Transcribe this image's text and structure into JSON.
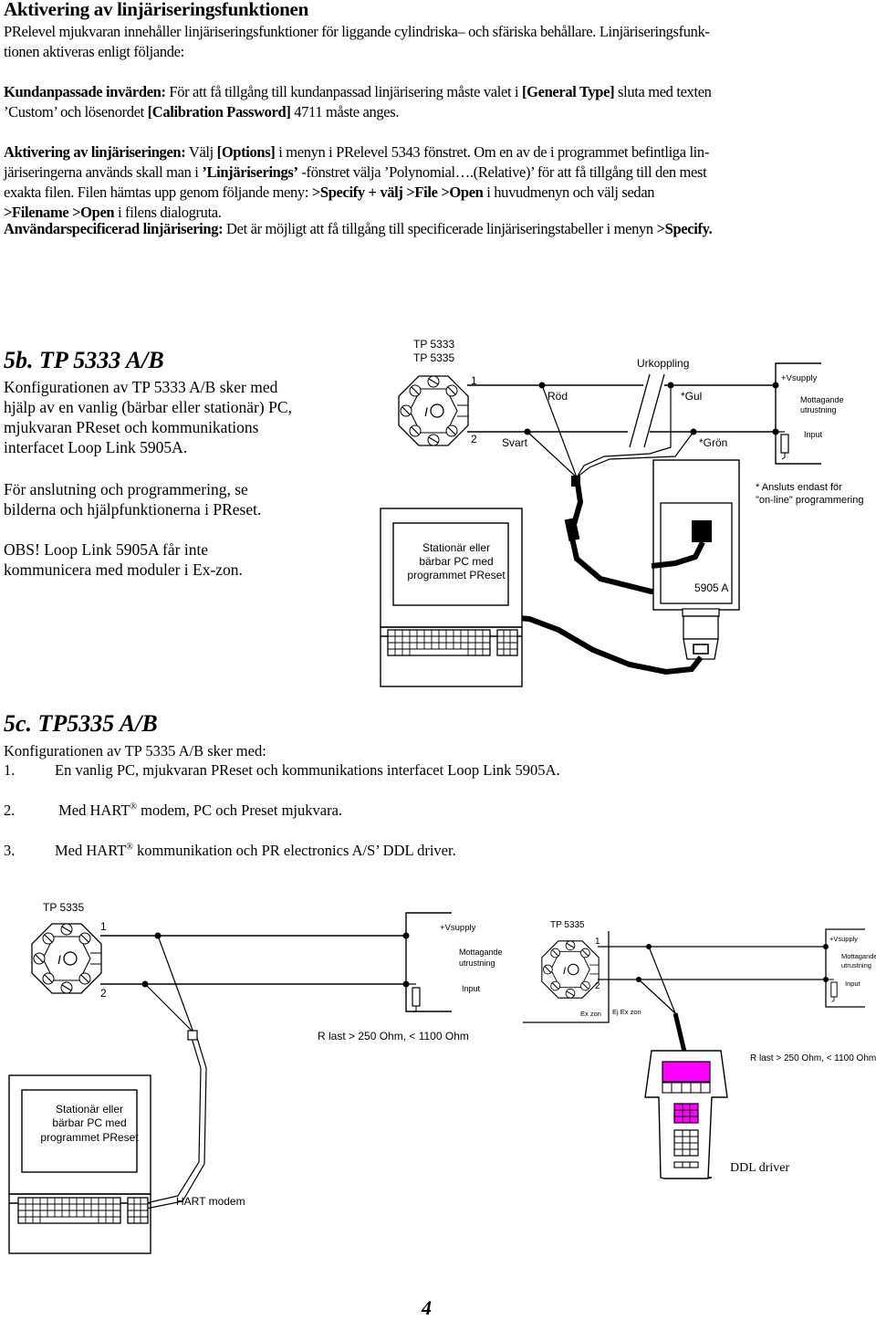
{
  "section_a": {
    "title": "Aktivering av linjäriseringsfunktionen",
    "intro_line1": "PRelevel mjukvaran innehåller linjäriseringsfunktioner för liggande cylindriska– och sfäriska behållare. Linjäriseringsfunk-",
    "intro_line2": "tionen aktiveras enligt följande:",
    "custom": {
      "label": "Kundanpassade invärden:",
      "t1": " För att få tillgång till kundanpassad linjärisering måste valet i ",
      "b1": "[General Type]",
      "t2": " sluta med texten",
      "t3": "’Custom’ och lösenordet ",
      "b2": "[Calibration Password]",
      "t4": " 4711 måste anges."
    },
    "activate": {
      "label": "Aktivering av linjäriseringen:",
      "t1": " Välj ",
      "b1": "[Options]",
      "t2": " i menyn i PRelevel 5343 fönstret. Om en av de i programmet befintliga lin-",
      "t3": "järiseringerna används skall man i ",
      "b2": "’Linjäriserings’",
      "t4": " -fönstret välja ’Polynomial….(Relative)’ för att få tillgång till den mest",
      "t5": "exakta filen. Filen hämtas upp genom följande meny: ",
      "b3": ">Specify + välj >File >Open",
      "t6": " i huvudmenyn och välj sedan",
      "b4": ">Filename >Open",
      "t7": " i filens dialogruta."
    },
    "user": {
      "label": "Användarspecificerad linjärisering:",
      "t1": " Det är möjligt att få tillgång till specificerade linjäriseringstabeller i menyn ",
      "b1": ">Specify."
    }
  },
  "section_5b": {
    "title": "5b.   TP 5333 A/B",
    "p1": [
      "Konfigurationen av TP 5333 A/B sker med",
      "hjälp av en vanlig (bärbar eller stationär) PC,",
      "mjukvaran PReset och kommunikations",
      "interfacet Loop Link 5905A."
    ],
    "p2": [
      "För anslutning och programmering, se",
      "bilderna och hjälpfunktionerna  i PReset."
    ],
    "p3": [
      "OBS! Loop Link 5905A får inte",
      "kommunicera med moduler i Ex-zon."
    ],
    "diagram": {
      "device_label_1": "TP 5333",
      "device_label_2": "TP 5335",
      "terminal_1": "1",
      "terminal_2": "2",
      "wire_red": "Röd",
      "wire_black": "Svart",
      "disconnect": "Urkoppling",
      "wire_yellow": "*Gul",
      "wire_green": "*Grön",
      "vsupply": "+Vsupply",
      "receiver_1": "Mottagande",
      "receiver_2": "utrustning",
      "input": "Input",
      "note_1": "* Ansluts endast för",
      "note_2": "\"on-line\" programmering",
      "pc_1": "Stationär eller",
      "pc_2": "bärbar PC med",
      "pc_3": "programmet PReset",
      "loop_link": "5905 A"
    }
  },
  "section_5c": {
    "title": "5c.   TP5335 A/B",
    "intro": "Konfigurationen av TP 5335 A/B sker med:",
    "items": [
      {
        "num": "1.",
        "text": "En vanlig PC, mjukvaran PReset och kommunikations interfacet Loop Link 5905A."
      },
      {
        "num": "2.",
        "pre": " Med HART",
        "sup": "®",
        "post": " modem, PC och Preset mjukvara."
      },
      {
        "num": "3.",
        "pre": "Med HART",
        "sup": "®",
        "post": " kommunikation och PR electronics A/S’ DDL driver."
      }
    ],
    "diagram_left": {
      "device_label": "TP 5335",
      "terminal_1": "1",
      "terminal_2": "2",
      "vsupply": "+Vsupply",
      "receiver_1": "Mottagande",
      "receiver_2": "utrustning",
      "input": "Input",
      "rload": "R last >  250 Ohm, < 1100 Ohm",
      "pc_1": "Stationär eller",
      "pc_2": "bärbar PC med",
      "pc_3": "programmet PReset",
      "modem": "HART modem"
    },
    "diagram_right": {
      "device_label": "TP 5335",
      "terminal_1": "1",
      "terminal_2": "2",
      "ex_zone": "Ex zon",
      "non_ex_zone": "Ej Ex zon",
      "vsupply": "+Vsupply",
      "receiver_1": "Mottagande",
      "receiver_2": "utrustning",
      "input": "Input",
      "rload": "R last > 250 Ohm, < 1100 Ohm",
      "handheld": "DDL driver"
    }
  },
  "page_number": "4",
  "colors": {
    "handheld_screen": "#ff00ff",
    "ink": "#000000"
  }
}
